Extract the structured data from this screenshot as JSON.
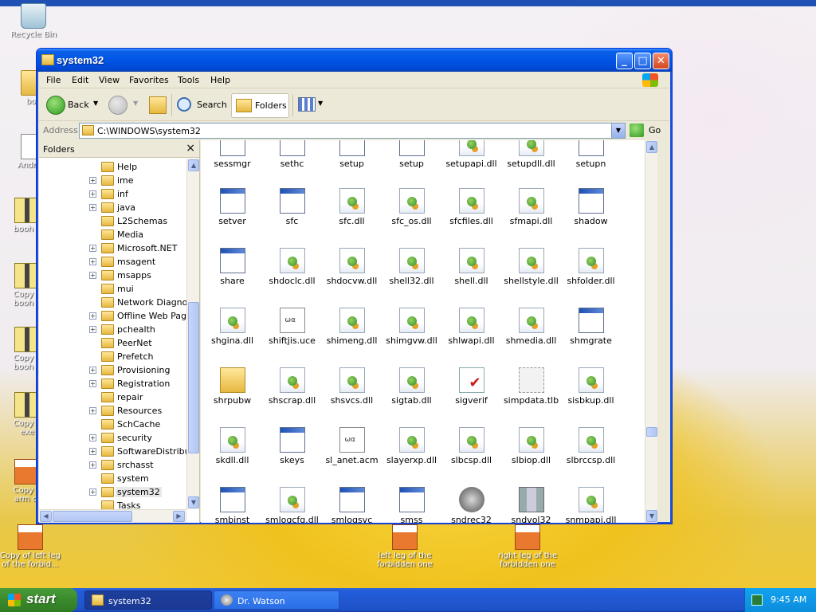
{
  "desktop": {
    "icons": [
      {
        "label": "Recycle Bin"
      },
      {
        "label": "boo"
      },
      {
        "label": "AndreiO"
      },
      {
        "label": "booh e"
      },
      {
        "label": "Copy o\nbooh e"
      },
      {
        "label": "Copy o\nbooh e"
      },
      {
        "label": "Copy o\nexe"
      },
      {
        "label": "Copy o\narm of"
      },
      {
        "label": "Copy of left leg\nof the forbid..."
      },
      {
        "label": "left leg of the\nforbidden one"
      },
      {
        "label": "right leg of the\nforbidden one"
      }
    ]
  },
  "window": {
    "title": "system32",
    "menu": [
      "File",
      "Edit",
      "View",
      "Favorites",
      "Tools",
      "Help"
    ],
    "toolbar": {
      "back": "Back",
      "search": "Search",
      "folders": "Folders"
    },
    "address": {
      "label": "Address",
      "path": "C:\\WINDOWS\\system32",
      "go": "Go"
    },
    "folders_pane": {
      "title": "Folders",
      "close": "×",
      "items": [
        {
          "label": "Help",
          "expandable": false
        },
        {
          "label": "ime",
          "expandable": true
        },
        {
          "label": "inf",
          "expandable": true
        },
        {
          "label": "java",
          "expandable": true
        },
        {
          "label": "L2Schemas",
          "expandable": false
        },
        {
          "label": "Media",
          "expandable": false
        },
        {
          "label": "Microsoft.NET",
          "expandable": true
        },
        {
          "label": "msagent",
          "expandable": true
        },
        {
          "label": "msapps",
          "expandable": true
        },
        {
          "label": "mui",
          "expandable": false
        },
        {
          "label": "Network Diagnost",
          "expandable": false
        },
        {
          "label": "Offline Web Page",
          "expandable": true
        },
        {
          "label": "pchealth",
          "expandable": true
        },
        {
          "label": "PeerNet",
          "expandable": false
        },
        {
          "label": "Prefetch",
          "expandable": false
        },
        {
          "label": "Provisioning",
          "expandable": true
        },
        {
          "label": "Registration",
          "expandable": true
        },
        {
          "label": "repair",
          "expandable": false
        },
        {
          "label": "Resources",
          "expandable": true
        },
        {
          "label": "SchCache",
          "expandable": false
        },
        {
          "label": "security",
          "expandable": true
        },
        {
          "label": "SoftwareDistribut",
          "expandable": true
        },
        {
          "label": "srchasst",
          "expandable": true
        },
        {
          "label": "system",
          "expandable": false
        },
        {
          "label": "system32",
          "expandable": true,
          "selected": true
        },
        {
          "label": "Tasks",
          "expandable": false
        }
      ]
    },
    "files": [
      [
        {
          "name": "sessmgr",
          "icon": "exe"
        },
        {
          "name": "sethc",
          "icon": "exe"
        },
        {
          "name": "setup",
          "icon": "exe"
        },
        {
          "name": "setup",
          "icon": "exe"
        },
        {
          "name": "setupapi.dll",
          "icon": "dll"
        },
        {
          "name": "setupdll.dll",
          "icon": "dll"
        },
        {
          "name": "setupn",
          "icon": "exe"
        }
      ],
      [
        {
          "name": "setver",
          "icon": "exe"
        },
        {
          "name": "sfc",
          "icon": "exe"
        },
        {
          "name": "sfc.dll",
          "icon": "dll"
        },
        {
          "name": "sfc_os.dll",
          "icon": "dll"
        },
        {
          "name": "sfcfiles.dll",
          "icon": "dll"
        },
        {
          "name": "sfmapi.dll",
          "icon": "dll"
        },
        {
          "name": "shadow",
          "icon": "exe"
        }
      ],
      [
        {
          "name": "share",
          "icon": "exe"
        },
        {
          "name": "shdoclc.dll",
          "icon": "dll"
        },
        {
          "name": "shdocvw.dll",
          "icon": "dll"
        },
        {
          "name": "shell32.dll",
          "icon": "dll"
        },
        {
          "name": "shell.dll",
          "icon": "dll"
        },
        {
          "name": "shellstyle.dll",
          "icon": "dll"
        },
        {
          "name": "shfolder.dll",
          "icon": "dll"
        }
      ],
      [
        {
          "name": "shgina.dll",
          "icon": "dll"
        },
        {
          "name": "shiftjis.uce",
          "icon": "ucs"
        },
        {
          "name": "shimeng.dll",
          "icon": "dll"
        },
        {
          "name": "shimgvw.dll",
          "icon": "dll"
        },
        {
          "name": "shlwapi.dll",
          "icon": "dll"
        },
        {
          "name": "shmedia.dll",
          "icon": "dll"
        },
        {
          "name": "shmgrate",
          "icon": "exe"
        }
      ],
      [
        {
          "name": "shrpubw",
          "icon": "folder"
        },
        {
          "name": "shscrap.dll",
          "icon": "dll"
        },
        {
          "name": "shsvcs.dll",
          "icon": "dll"
        },
        {
          "name": "sigtab.dll",
          "icon": "dll"
        },
        {
          "name": "sigverif",
          "icon": "check"
        },
        {
          "name": "simpdata.tlb",
          "icon": "tlb"
        },
        {
          "name": "sisbkup.dll",
          "icon": "dll"
        }
      ],
      [
        {
          "name": "skdll.dll",
          "icon": "dll"
        },
        {
          "name": "skeys",
          "icon": "exe"
        },
        {
          "name": "sl_anet.acm",
          "icon": "ucs"
        },
        {
          "name": "slayerxp.dll",
          "icon": "dll"
        },
        {
          "name": "slbcsp.dll",
          "icon": "dll"
        },
        {
          "name": "slbiop.dll",
          "icon": "dll"
        },
        {
          "name": "slbrccsp.dll",
          "icon": "dll"
        }
      ],
      [
        {
          "name": "smbinst",
          "icon": "exe"
        },
        {
          "name": "smlogcfg.dll",
          "icon": "dll"
        },
        {
          "name": "smlogsvc",
          "icon": "exe"
        },
        {
          "name": "smss",
          "icon": "exe"
        },
        {
          "name": "sndrec32",
          "icon": "speaker"
        },
        {
          "name": "sndvol32",
          "icon": "spool"
        },
        {
          "name": "snmpapi.dll",
          "icon": "dll"
        }
      ]
    ]
  },
  "taskbar": {
    "start": "start",
    "tasks": [
      {
        "label": "system32",
        "active": true
      },
      {
        "label": "Dr. Watson",
        "active": false
      }
    ],
    "clock": "9:45 AM"
  }
}
